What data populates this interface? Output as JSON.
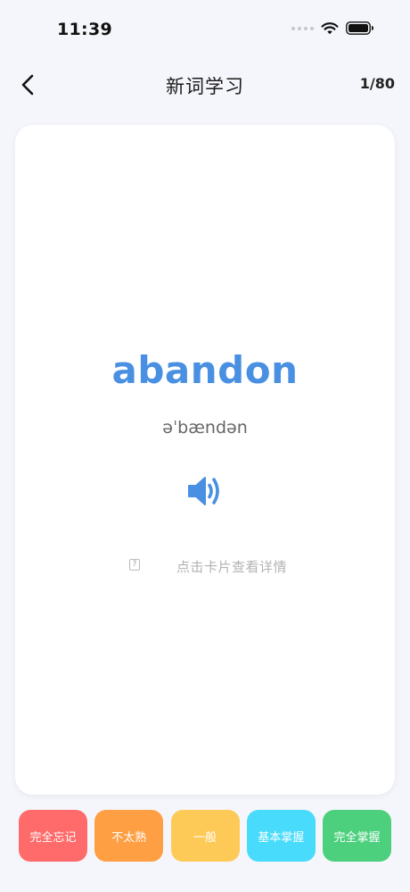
{
  "status_bar": {
    "time": "11:39"
  },
  "header": {
    "title": "新词学习",
    "progress": "1/80"
  },
  "card": {
    "word": "abandon",
    "phonetic": "əˈbændən",
    "hint": "点击卡片查看详情",
    "hint_icon_glyph": "?"
  },
  "rating_buttons": [
    {
      "label": "完全忘记",
      "color": "#ff6b6b"
    },
    {
      "label": "不太熟",
      "color": "#ff9f43"
    },
    {
      "label": "一般",
      "color": "#feca57"
    },
    {
      "label": "基本掌握",
      "color": "#48dbfb"
    },
    {
      "label": "完全掌握",
      "color": "#4cd07d"
    }
  ],
  "colors": {
    "accent": "#4a90e2",
    "background": "#f5f6fb",
    "card": "#ffffff"
  },
  "icons": {
    "back": "chevron-left-icon",
    "speaker": "speaker-icon",
    "signal": "signal-dots-icon",
    "wifi": "wifi-icon",
    "battery": "battery-icon",
    "hint": "hint-icon"
  }
}
